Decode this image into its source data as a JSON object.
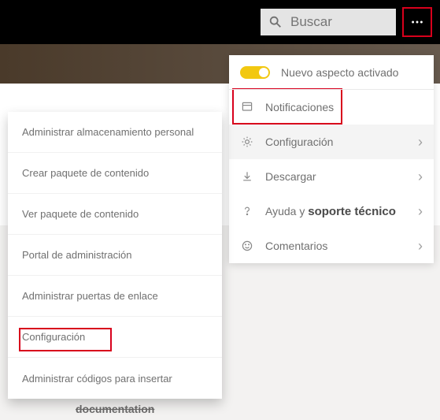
{
  "search": {
    "placeholder": "Buscar"
  },
  "rightPanel": {
    "toggleLabel": "Nuevo aspecto activado",
    "items": [
      {
        "label": "Notificaciones"
      },
      {
        "label": "Configuración"
      },
      {
        "label": "Descargar"
      },
      {
        "helpPrefix": "Ayuda y ",
        "helpStrong": "soporte técnico"
      },
      {
        "label": "Comentarios"
      }
    ]
  },
  "leftPanel": {
    "items": [
      "Administrar almacenamiento personal",
      "Crear paquete de contenido",
      "Ver paquete de contenido",
      "Portal de administración",
      "Administrar puertas de enlace",
      "Configuración",
      "Administrar códigos para insertar"
    ]
  },
  "fragment": "documentation"
}
